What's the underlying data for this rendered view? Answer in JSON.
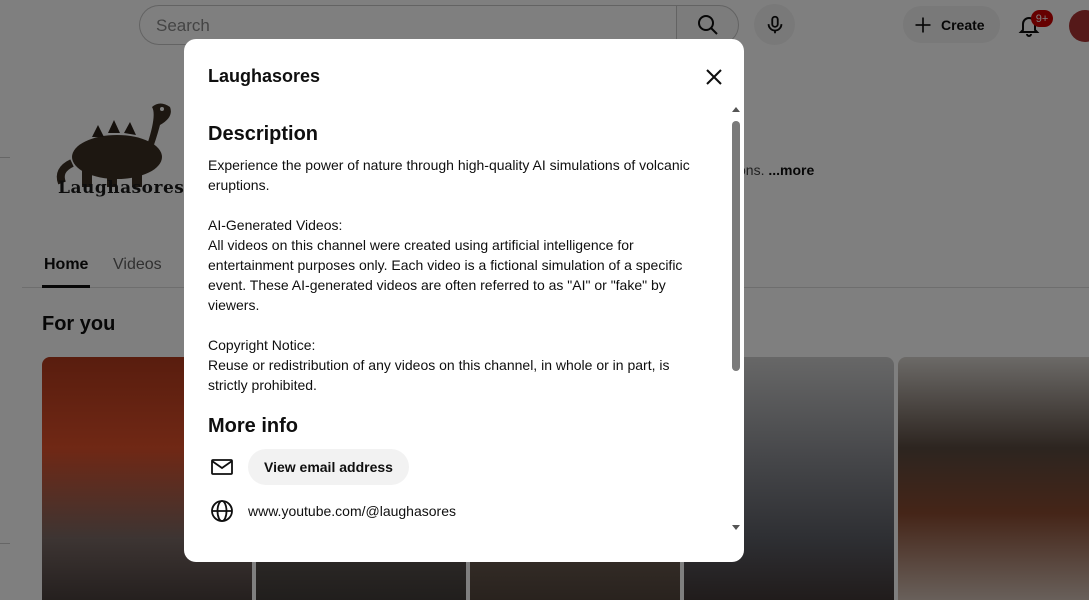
{
  "header": {
    "search_placeholder": "Search",
    "create_label": "Create",
    "notification_count": "9+",
    "icons": [
      "search-icon",
      "mic-icon",
      "plus-icon",
      "bell-icon",
      "avatar"
    ]
  },
  "channel": {
    "logo_text": "Laughasores",
    "description_snippet_tail": "ons.",
    "more_link": "...more"
  },
  "tabs": [
    {
      "label": "Home",
      "active": true
    },
    {
      "label": "Videos",
      "active": false
    }
  ],
  "feed": {
    "section_title": "For you"
  },
  "modal": {
    "title": "Laughasores",
    "description_heading": "Description",
    "description": "Experience the power of nature through high-quality AI simulations of volcanic eruptions.\n\nAI-Generated Videos:\nAll videos on this channel were created using artificial intelligence for entertainment purposes only. Each video is a fictional simulation of a specific event. These AI-generated videos are often referred to as \"AI\" or \"fake\" by viewers.\n\nCopyright Notice:\nReuse or redistribution of any videos on this channel, in whole or in part, is strictly prohibited.",
    "more_info_heading": "More info",
    "email_button_label": "View email address",
    "channel_link": "www.youtube.com/@laughasores"
  },
  "colors": {
    "overlay": "#000000",
    "accent_red": "#cc0000",
    "chip_bg": "#f2f2f2",
    "text": "#0f0f0f"
  }
}
